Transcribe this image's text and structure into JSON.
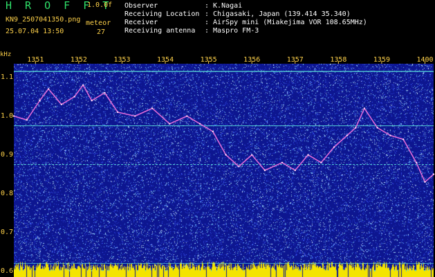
{
  "header": {
    "brand": "H R O F F T",
    "version": "1.0.0f",
    "filename": "KN9_2507041350.png",
    "datetime": "25.07.04 13:50",
    "meteor_label": "meteor",
    "meteor_count": "27",
    "observer_label": "Observer",
    "observer_value": ": K.Nagai",
    "location_label": "Receiving Location",
    "location_value": ": Chigasaki, Japan (139.414 35.340)",
    "receiver_label": "Receiver",
    "receiver_value": ": AirSpy mini (Miakejima VOR 108.65MHz)",
    "antenna_label": "Receiving antenna",
    "antenna_value": ": Maspro FM-3"
  },
  "colors": {
    "background": "#000000",
    "spectrum_bg": "#0d1690",
    "trace": "#e06ad8",
    "lines": "#60f0e0",
    "labels": "#ffd24a",
    "brand": "#2fe06a",
    "bottom_bar": "#f4e400",
    "bottom_band": "#33d8ff"
  },
  "chart_data": {
    "type": "line",
    "x_unit": "time (HHMM)",
    "y_unit": "kHz",
    "xlabel": "",
    "ylabel": "kHz",
    "x_ticks": [
      "1351",
      "1352",
      "1353",
      "1354",
      "1355",
      "1356",
      "1357",
      "1358",
      "1359",
      "1400"
    ],
    "y_ticks": [
      "1.1",
      "1.0",
      "0.9",
      "0.8",
      "0.7",
      "0.6"
    ],
    "ylim": [
      0.585,
      1.135
    ],
    "xlim": [
      1350.5,
      1400.2
    ],
    "grid": false,
    "horizontal_lines_khz": [
      1.115,
      0.975,
      0.875,
      0.62
    ],
    "series": [
      {
        "x": [
          1350.5,
          1350.8,
          1351.1,
          1351.3,
          1351.6,
          1351.9,
          1352.1,
          1352.3,
          1352.6,
          1352.9,
          1353.3,
          1353.7,
          1354.1,
          1354.5,
          1354.8,
          1355.1,
          1355.4,
          1355.7,
          1356.0,
          1356.3,
          1356.7,
          1357.0,
          1357.3,
          1357.6,
          1357.9,
          1358.2,
          1358.4,
          1358.6,
          1358.9,
          1359.2,
          1359.5,
          1359.8,
          1400.0,
          1400.2
        ],
        "y": [
          1.0,
          0.99,
          1.04,
          1.07,
          1.03,
          1.05,
          1.08,
          1.04,
          1.06,
          1.01,
          1.0,
          1.02,
          0.98,
          1.0,
          0.98,
          0.96,
          0.9,
          0.87,
          0.9,
          0.86,
          0.88,
          0.86,
          0.9,
          0.88,
          0.92,
          0.95,
          0.97,
          1.02,
          0.97,
          0.95,
          0.94,
          0.88,
          0.83,
          0.85
        ]
      }
    ]
  }
}
